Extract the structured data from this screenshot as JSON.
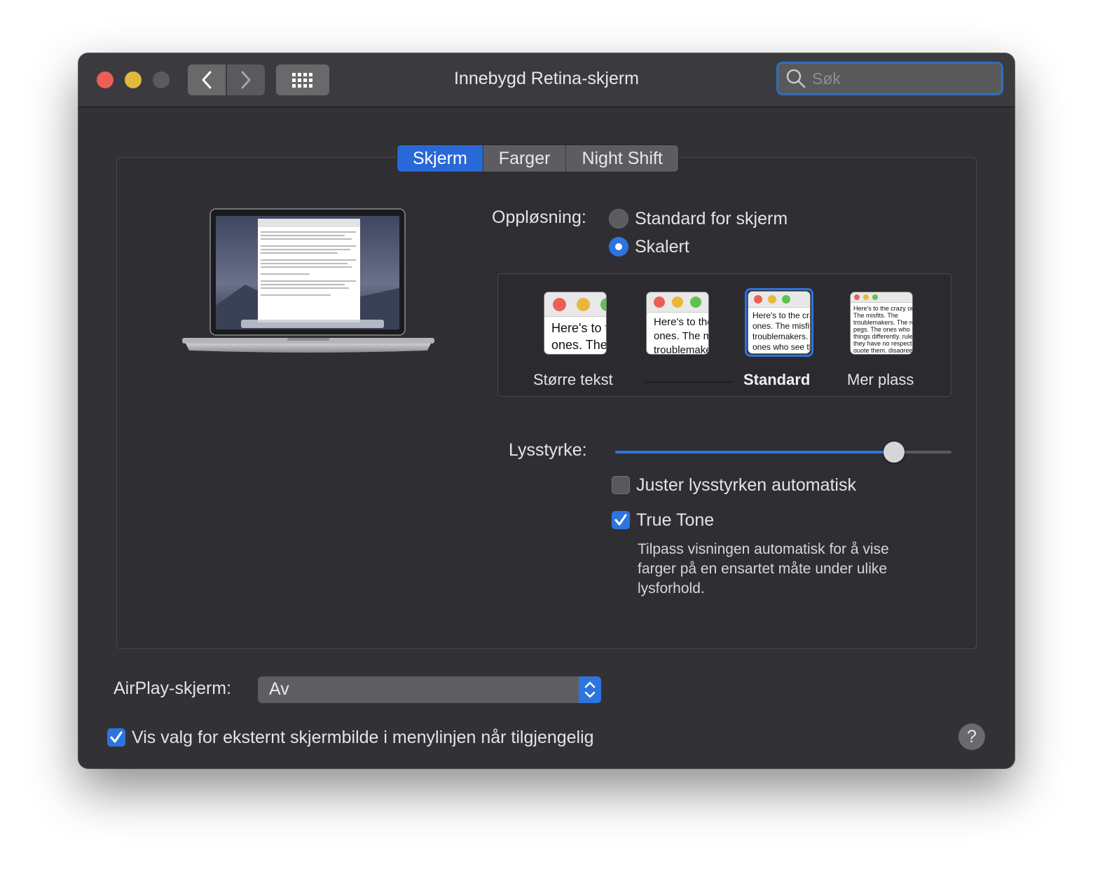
{
  "window": {
    "title": "Innebygd Retina-skjerm"
  },
  "toolbar": {
    "back_icon": "chevron-left-icon",
    "forward_icon": "chevron-right-icon",
    "grid_icon": "grid-icon",
    "search_placeholder": "Søk"
  },
  "tabs": [
    {
      "label": "Skjerm",
      "active": true
    },
    {
      "label": "Farger",
      "active": false
    },
    {
      "label": "Night Shift",
      "active": false
    }
  ],
  "resolution": {
    "label": "Oppløsning:",
    "options": [
      {
        "label": "Standard for skjerm",
        "selected": false
      },
      {
        "label": "Skalert",
        "selected": true
      }
    ]
  },
  "scaling": {
    "options": [
      {
        "label": "Større tekst",
        "preview": "Here's to the crazy ones. The misfits. The troublemakers."
      },
      {
        "label": "",
        "preview": "Here's to the crazy ones. The misfits. The troublemakers. The round pegs. The ones who see"
      },
      {
        "label": "Standard",
        "selected": true,
        "preview": "Here's to the crazy ones. The misfits. The troublemakers. The ones who see things. The rules. And they have"
      },
      {
        "label": "Mer plass",
        "preview": "Here's to the crazy ones. The misfits. The troublemakers. The round pegs. The ones who see things differently. rules. And they have no respect. can quote them, disagree with them. About the only thing. Because they change things."
      }
    ]
  },
  "brightness": {
    "label": "Lysstyrke:",
    "value": 0.83
  },
  "auto_brightness": {
    "label": "Juster lysstyrken automatisk",
    "checked": false
  },
  "true_tone": {
    "label": "True Tone",
    "checked": true,
    "description_lines": [
      "Tilpass visningen automatisk for å vise",
      "farger på en ensartet måte under ulike",
      "lysforhold."
    ]
  },
  "airplay": {
    "label": "AirPlay-skjerm:",
    "value": "Av"
  },
  "menubar_option": {
    "label": "Vis valg for eksternt skjermbilde i menylinjen når tilgjengelig",
    "checked": true
  },
  "help": {
    "label": "?"
  },
  "colors": {
    "accent": "#2e74df",
    "window_bg": "#323236"
  }
}
